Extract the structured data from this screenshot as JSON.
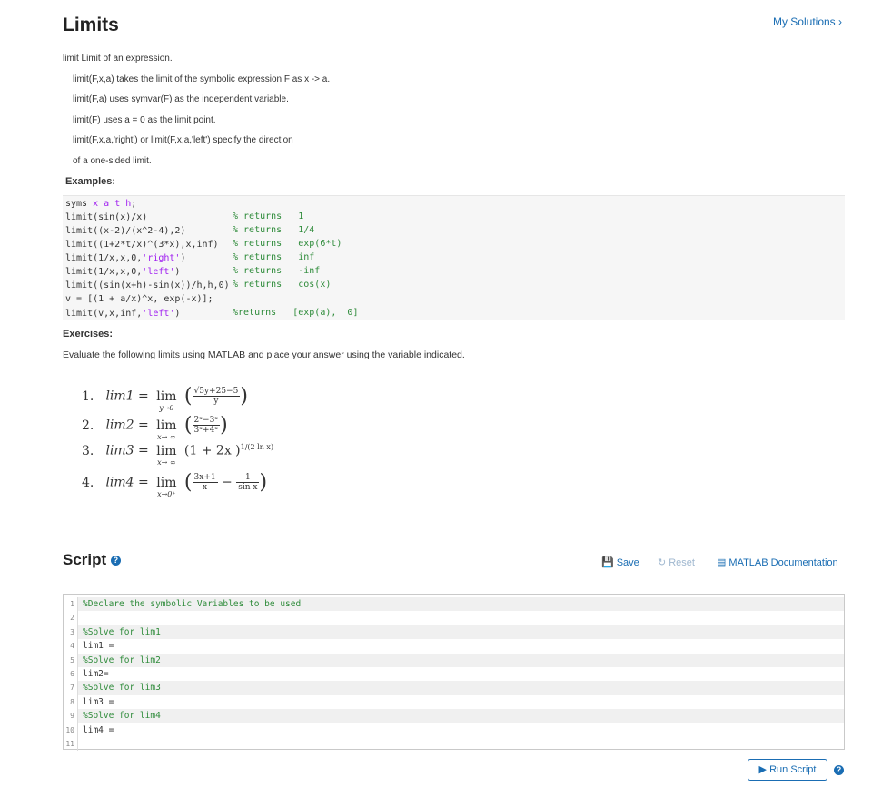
{
  "header": {
    "title": "Limits",
    "my_solutions": "My Solutions ›"
  },
  "description": [
    "limit   Limit of an expression.",
    "limit(F,x,a) takes the limit of the symbolic expression F as x -> a.",
    "limit(F,a) uses symvar(F) as the independent variable.",
    "limit(F) uses a = 0 as the limit point.",
    "limit(F,x,a,'right') or limit(F,x,a,'left') specify the direction",
    "of a one-sided limit."
  ],
  "examples_label": "Examples:",
  "examples": [
    {
      "code": "syms x a t h;",
      "comment": ""
    },
    {
      "code": "limit(sin(x)/x)",
      "comment": "% returns   1"
    },
    {
      "code": "limit((x-2)/(x^2-4),2)",
      "comment": "% returns   1/4"
    },
    {
      "code": "limit((1+2*t/x)^(3*x),x,inf)",
      "comment": "% returns   exp(6*t)"
    },
    {
      "code": "limit(1/x,x,0,'right')",
      "comment": "% returns   inf"
    },
    {
      "code": "limit(1/x,x,0,'left')",
      "comment": "% returns   -inf"
    },
    {
      "code": "limit((sin(x+h)-sin(x))/h,h,0)",
      "comment": "% returns   cos(x)"
    },
    {
      "code": "v = [(1 + a/x)^x, exp(-x)];",
      "comment": ""
    },
    {
      "code": "limit(v,x,inf,'left')",
      "comment": "%returns   [exp(a),  0]"
    }
  ],
  "exercises_label": "Exercises:",
  "instructions": "Evaluate the following limits using MATLAB and place your answer using the variable indicated.",
  "exercises": [
    {
      "num": "1.",
      "var": "lim1",
      "sub": "y→0",
      "numer": "√5y+25−5",
      "denom": "y"
    },
    {
      "num": "2.",
      "var": "lim2",
      "sub": "x→ ∞",
      "numer": "2ˣ−3ˣ",
      "denom": "3ˣ+4ˣ"
    },
    {
      "num": "3.",
      "var": "lim3",
      "sub": "x→ ∞",
      "body": "(1 + 2x )",
      "exp": "1/(2 ln x)"
    },
    {
      "num": "4.",
      "var": "lim4",
      "sub": "x→0⁺",
      "numer": "3x+1",
      "denom": "x",
      "numer2": "1",
      "denom2": "sin x"
    }
  ],
  "script": {
    "title": "Script",
    "save": "Save",
    "reset": "Reset",
    "docs": "MATLAB Documentation",
    "lines": [
      "%Declare the symbolic Variables to be used",
      "",
      "%Solve for lim1",
      "lim1 =",
      "%Solve for lim2",
      "lim2=",
      "%Solve for lim3",
      "lim3 =",
      "%Solve for lim4",
      "lim4 =",
      ""
    ],
    "line_numbers": [
      "1",
      "2",
      "3",
      "4",
      "5",
      "6",
      "7",
      "8",
      "9",
      "10",
      "11"
    ],
    "run": "Run Script"
  },
  "colors": {
    "accent": "#1a6db3",
    "comment": "#2e8b3a",
    "string": "#a020f0"
  }
}
